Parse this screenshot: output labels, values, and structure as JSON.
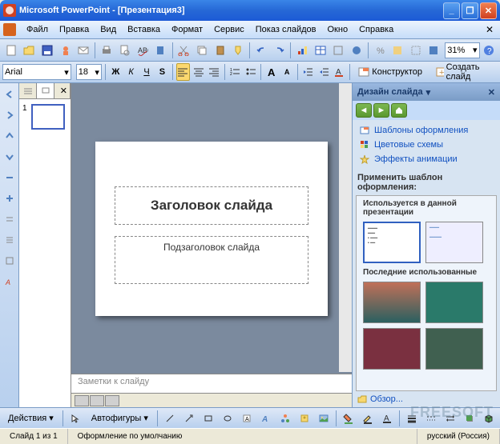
{
  "title": "Microsoft PowerPoint - [Презентация3]",
  "menu": {
    "file": "Файл",
    "edit": "Правка",
    "view": "Вид",
    "insert": "Вставка",
    "format": "Формат",
    "tools": "Сервис",
    "slideshow": "Показ слайдов",
    "window": "Окно",
    "help": "Справка"
  },
  "toolbar": {
    "zoom": "31%"
  },
  "format": {
    "font": "Arial",
    "size": "18",
    "designer": "Конструктор",
    "new_slide": "Создать слайд"
  },
  "outline": {
    "slide_num": "1"
  },
  "slide": {
    "title": "Заголовок слайда",
    "subtitle": "Подзаголовок слайда"
  },
  "notes": {
    "placeholder": "Заметки к слайду"
  },
  "taskpane": {
    "title": "Дизайн слайда",
    "link1": "Шаблоны оформления",
    "link2": "Цветовые схемы",
    "link3": "Эффекты анимации",
    "apply": "Применить шаблон оформления:",
    "group1": "Используется в данной презентации",
    "group2": "Последние использованные",
    "browse": "Обзор..."
  },
  "draw": {
    "actions": "Действия",
    "autoshapes": "Автофигуры"
  },
  "status": {
    "slide": "Слайд 1 из 1",
    "design": "Оформление по умолчанию",
    "lang": "русский (Россия)"
  },
  "watermark": "FREESOFT"
}
